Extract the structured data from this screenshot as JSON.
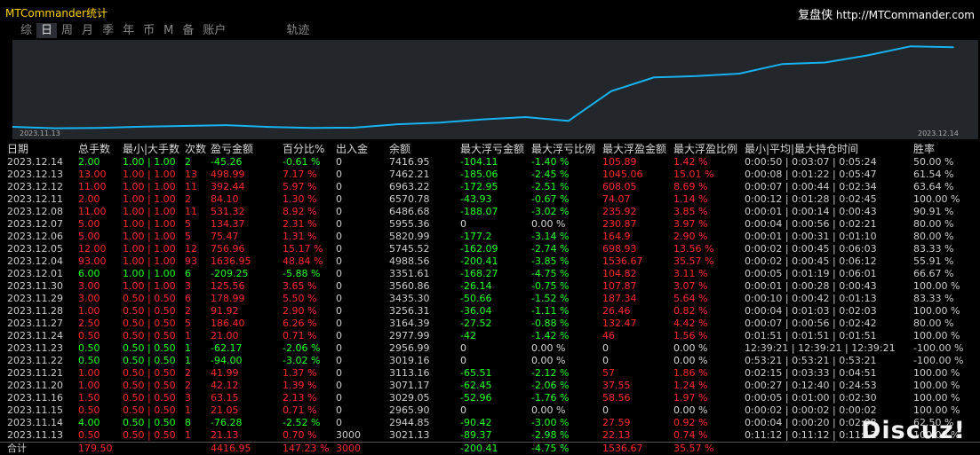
{
  "app": {
    "title": "MTCommander统计",
    "brand_cn": "复盘侠",
    "brand_url": "http://MTCommander.com"
  },
  "tabs": [
    "综",
    "日",
    "周",
    "月",
    "季",
    "年",
    "币",
    "M",
    "备",
    "账户",
    "轨迹"
  ],
  "active_tab": "日",
  "chart": {
    "x_start": "2023.11.13",
    "x_end": "2023.12.14",
    "line_color": "#19b2f0"
  },
  "chart_data": {
    "type": "line",
    "x": [
      "2023.11.13",
      "2023.11.14",
      "2023.11.15",
      "2023.11.16",
      "2023.11.20",
      "2023.11.21",
      "2023.11.22",
      "2023.11.23",
      "2023.11.24",
      "2023.11.27",
      "2023.11.28",
      "2023.11.29",
      "2023.11.30",
      "2023.12.01",
      "2023.12.04",
      "2023.12.05",
      "2023.12.06",
      "2023.12.07",
      "2023.12.08",
      "2023.12.11",
      "2023.12.12",
      "2023.12.13",
      "2023.12.14"
    ],
    "values": [
      3021.13,
      2944.85,
      2965.9,
      3029.05,
      3071.17,
      3113.16,
      3019.16,
      2956.99,
      2977.99,
      3164.39,
      3256.31,
      3435.3,
      3560.86,
      3351.61,
      4988.56,
      5745.52,
      5820.99,
      5955.36,
      6486.68,
      6570.78,
      6963.22,
      7462.21,
      7416.95
    ],
    "xlabel": "",
    "ylabel": ""
  },
  "headers": [
    "日期",
    "总手数",
    "最小|大手数",
    "次数",
    "盈亏金额",
    "百分比%",
    "出入金",
    "余额",
    "最大浮亏金额",
    "最大浮亏比例",
    "最大浮盈金额",
    "最大浮盈比例",
    "最小|平均|最大持仓时间",
    "胜率"
  ],
  "rows": [
    [
      "2023.12.14",
      "2.00",
      "1.00 | 1.00",
      "2",
      "-45.26",
      "-0.61 %",
      "0",
      "7416.95",
      "-104.11",
      "-1.40 %",
      "105.89",
      "1.42 %",
      "0:00:50 | 0:03:07 | 0:05:24",
      "50.00 %"
    ],
    [
      "2023.12.13",
      "13.00",
      "1.00 | 1.00",
      "13",
      "498.99",
      "7.17 %",
      "0",
      "7462.21",
      "-185.06",
      "-2.45 %",
      "1045.06",
      "15.01 %",
      "0:00:08 | 0:01:22 | 0:05:47",
      "61.54 %"
    ],
    [
      "2023.12.12",
      "11.00",
      "1.00 | 1.00",
      "11",
      "392.44",
      "5.97 %",
      "0",
      "6963.22",
      "-172.95",
      "-2.51 %",
      "608.05",
      "8.69 %",
      "0:00:07 | 0:00:44 | 0:02:34",
      "63.64 %"
    ],
    [
      "2023.12.11",
      "2.00",
      "1.00 | 1.00",
      "2",
      "84.10",
      "1.30 %",
      "0",
      "6570.78",
      "-43.93",
      "-0.67 %",
      "74.07",
      "1.14 %",
      "0:00:12 | 0:01:28 | 0:02:45",
      "100.00 %"
    ],
    [
      "2023.12.08",
      "11.00",
      "1.00 | 1.00",
      "11",
      "531.32",
      "8.92 %",
      "0",
      "6486.68",
      "-188.07",
      "-3.02 %",
      "235.92",
      "3.85 %",
      "0:00:01 | 0:00:14 | 0:00:43",
      "90.91 %"
    ],
    [
      "2023.12.07",
      "5.00",
      "1.00 | 1.00",
      "5",
      "134.37",
      "2.31 %",
      "0",
      "5955.36",
      "0",
      "0.00 %",
      "230.87",
      "3.97 %",
      "0:00:04 | 0:00:56 | 0:02:21",
      "80.00 %"
    ],
    [
      "2023.12.06",
      "5.00",
      "1.00 | 1.00",
      "5",
      "75.47",
      "1.31 %",
      "0",
      "5820.99",
      "-177.2",
      "-3.14 %",
      "164.9",
      "2.90 %",
      "0:00:01 | 0:00:31 | 0:01:10",
      "80.00 %"
    ],
    [
      "2023.12.05",
      "12.00",
      "1.00 | 1.00",
      "12",
      "756.96",
      "15.17 %",
      "0",
      "5745.52",
      "-162.09",
      "-2.74 %",
      "698.93",
      "13.56 %",
      "0:00:02 | 0:00:45 | 0:06:03",
      "83.33 %"
    ],
    [
      "2023.12.04",
      "93.00",
      "1.00 | 1.00",
      "93",
      "1636.95",
      "48.84 %",
      "0",
      "4988.56",
      "-200.41",
      "-3.85 %",
      "1536.67",
      "35.57 %",
      "0:00:02 | 0:00:45 | 0:06:12",
      "55.91 %"
    ],
    [
      "2023.12.01",
      "6.00",
      "1.00 | 1.00",
      "6",
      "-209.25",
      "-5.88 %",
      "0",
      "3351.61",
      "-168.27",
      "-4.75 %",
      "104.82",
      "3.11 %",
      "0:00:05 | 0:01:19 | 0:06:01",
      "66.67 %"
    ],
    [
      "2023.11.30",
      "3.00",
      "1.00 | 1.00",
      "3",
      "125.56",
      "3.65 %",
      "0",
      "3560.86",
      "-26.14",
      "-0.75 %",
      "107.87",
      "3.07 %",
      "0:00:01 | 0:00:28 | 0:00:43",
      "100.00 %"
    ],
    [
      "2023.11.29",
      "3.00",
      "0.50 | 0.50",
      "6",
      "178.99",
      "5.50 %",
      "0",
      "3435.30",
      "-50.66",
      "-1.52 %",
      "187.34",
      "5.64 %",
      "0:00:10 | 0:00:42 | 0:01:13",
      "83.33 %"
    ],
    [
      "2023.11.28",
      "1.00",
      "0.50 | 0.50",
      "2",
      "91.92",
      "2.90 %",
      "0",
      "3256.31",
      "-36.04",
      "-1.11 %",
      "26.46",
      "0.82 %",
      "0:00:04 | 0:01:03 | 0:02:03",
      "100.00 %"
    ],
    [
      "2023.11.27",
      "2.50",
      "0.50 | 0.50",
      "5",
      "186.40",
      "6.26 %",
      "0",
      "3164.39",
      "-27.52",
      "-0.88 %",
      "132.47",
      "4.42 %",
      "0:00:07 | 0:00:56 | 0:02:42",
      "80.00 %"
    ],
    [
      "2023.11.24",
      "0.50",
      "0.50 | 0.50",
      "1",
      "21.00",
      "0.71 %",
      "0",
      "2977.99",
      "-42",
      "-1.42 %",
      "46",
      "1.56 %",
      "0:01:51 | 0:01:51 | 0:01:51",
      "100.00 %"
    ],
    [
      "2023.11.23",
      "0.50",
      "0.50 | 0.50",
      "1",
      "-62.17",
      "-2.06 %",
      "0",
      "2956.99",
      "0",
      "0.00 %",
      "0",
      "0.00 %",
      "12:39:21 | 12:39:21 | 12:39:21",
      "-100.00 %"
    ],
    [
      "2023.11.22",
      "0.50",
      "0.50 | 0.50",
      "1",
      "-94.00",
      "-3.02 %",
      "0",
      "3019.16",
      "0",
      "0.00 %",
      "0",
      "0.00 %",
      "0:53:21 | 0:53:21 | 0:53:21",
      "-100.00 %"
    ],
    [
      "2023.11.21",
      "1.00",
      "0.50 | 0.50",
      "2",
      "41.99",
      "1.37 %",
      "0",
      "3113.16",
      "-65.51",
      "-2.12 %",
      "57",
      "1.86 %",
      "0:02:15 | 0:03:33 | 0:04:51",
      "100.00 %"
    ],
    [
      "2023.11.20",
      "1.00",
      "0.50 | 0.50",
      "2",
      "42.12",
      "1.39 %",
      "0",
      "3071.17",
      "-62.45",
      "-2.06 %",
      "37.55",
      "1.24 %",
      "0:00:27 | 0:12:40 | 0:24:53",
      "100.00 %"
    ],
    [
      "2023.11.16",
      "1.50",
      "0.50 | 0.50",
      "3",
      "63.15",
      "2.13 %",
      "0",
      "3029.05",
      "-52.96",
      "-1.76 %",
      "58.56",
      "1.97 %",
      "0:00:05 | 0:01:00 | 0:02:30",
      "100.00 %"
    ],
    [
      "2023.11.15",
      "0.50",
      "0.50 | 0.50",
      "1",
      "21.05",
      "0.71 %",
      "0",
      "2965.90",
      "0",
      "0.00 %",
      "0",
      "0.00 %",
      "0:00:02 | 0:00:02 | 0:00:02",
      "100.00 %"
    ],
    [
      "2023.11.14",
      "4.00",
      "0.50 | 0.50",
      "8",
      "-76.28",
      "-2.52 %",
      "0",
      "2944.85",
      "-90.42",
      "-3.00 %",
      "27.59",
      "0.92 %",
      "0:00:04 | 0:00:20 | 0:02:08",
      "62.50 %"
    ],
    [
      "2023.11.13",
      "0.50",
      "0.50 | 0.50",
      "1",
      "21.13",
      "0.70 %",
      "3000",
      "3021.13",
      "-89.37",
      "-2.98 %",
      "22.13",
      "0.74 %",
      "0:11:12 | 0:11:12 | 0:11:12",
      "100.00 %"
    ]
  ],
  "total": [
    "合计",
    "179.50",
    "",
    "",
    "4416.95",
    "147.23 %",
    "3000",
    "",
    "-200.41",
    "-4.75 %",
    "1536.67",
    "35.57 %",
    "",
    ""
  ],
  "watermark": "Discuz!"
}
